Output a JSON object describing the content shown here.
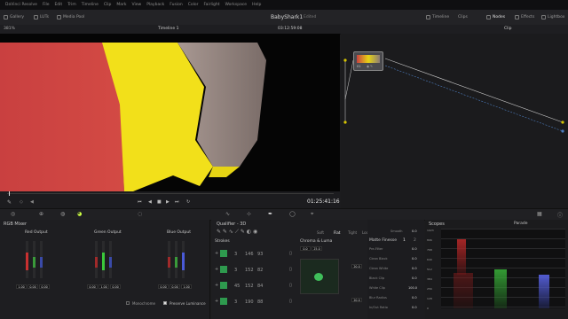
{
  "menubar": {
    "items": [
      "DaVinci Resolve",
      "File",
      "Edit",
      "Trim",
      "Timeline",
      "Clip",
      "Mark",
      "View",
      "Playback",
      "Fusion",
      "Color",
      "Fairlight",
      "Workspace",
      "Help"
    ]
  },
  "toolbar": {
    "gallery": "Gallery",
    "luts": "LUTs",
    "media_pool": "Media Pool",
    "project": "BabyShark1",
    "status": "Edited",
    "right_tabs": [
      "Timeline",
      "Clips",
      "Nodes",
      "Effects",
      "Lightbox"
    ]
  },
  "viewer": {
    "zoom": "381%",
    "timeline": "Timeline 1",
    "timecode": "03:12:59:08",
    "timecode_main": "01:25:41:16",
    "clip_label": "Clip"
  },
  "nodes": {
    "node_label": "01"
  },
  "rgb_mixer": {
    "title": "RGB Mixer",
    "outputs": [
      {
        "label": "Red Output",
        "values": [
          "1.00",
          "0.00",
          "0.00"
        ]
      },
      {
        "label": "Green Output",
        "values": [
          "0.00",
          "1.00",
          "0.00"
        ]
      },
      {
        "label": "Blue Output",
        "values": [
          "0.00",
          "0.00",
          "1.00"
        ]
      }
    ],
    "monochrome": "Monochrome",
    "preserve": "Preserve Luminance"
  },
  "qualifier": {
    "title": "Qualifier - 3D",
    "strokes_title": "Strokes",
    "strokes": [
      [
        "3",
        "146",
        "93"
      ],
      [
        "3",
        "152",
        "82"
      ],
      [
        "45",
        "152",
        "84"
      ],
      [
        "3",
        "190",
        "88"
      ]
    ],
    "chroma_title": "Chroma & Luma",
    "modes": [
      "Soft",
      "Flat",
      "Tight",
      "Loose"
    ],
    "chroma_inputs": [
      "0.0",
      "25.0"
    ],
    "chroma_side": [
      "20.0",
      "20.0"
    ]
  },
  "matte": {
    "title": "Matte Finesse",
    "tabs": [
      "1",
      "2"
    ],
    "rows": [
      {
        "label": "Pre-Filter",
        "value": "0.0"
      },
      {
        "label": "Clean Black",
        "value": "0.0"
      },
      {
        "label": "Clean White",
        "value": "0.0"
      },
      {
        "label": "Black Clip",
        "value": "0.0"
      },
      {
        "label": "White Clip",
        "value": "100.0"
      },
      {
        "label": "Blur Radius",
        "value": "0.0"
      },
      {
        "label": "In/Out Ratio",
        "value": "0.0"
      }
    ],
    "smooth_label": "Smooth",
    "smooth_value": "0.0"
  },
  "scopes": {
    "title": "Scopes",
    "mode": "Parade",
    "axis": [
      "1023",
      "896",
      "768",
      "640",
      "512",
      "384",
      "256",
      "128",
      "0"
    ]
  }
}
